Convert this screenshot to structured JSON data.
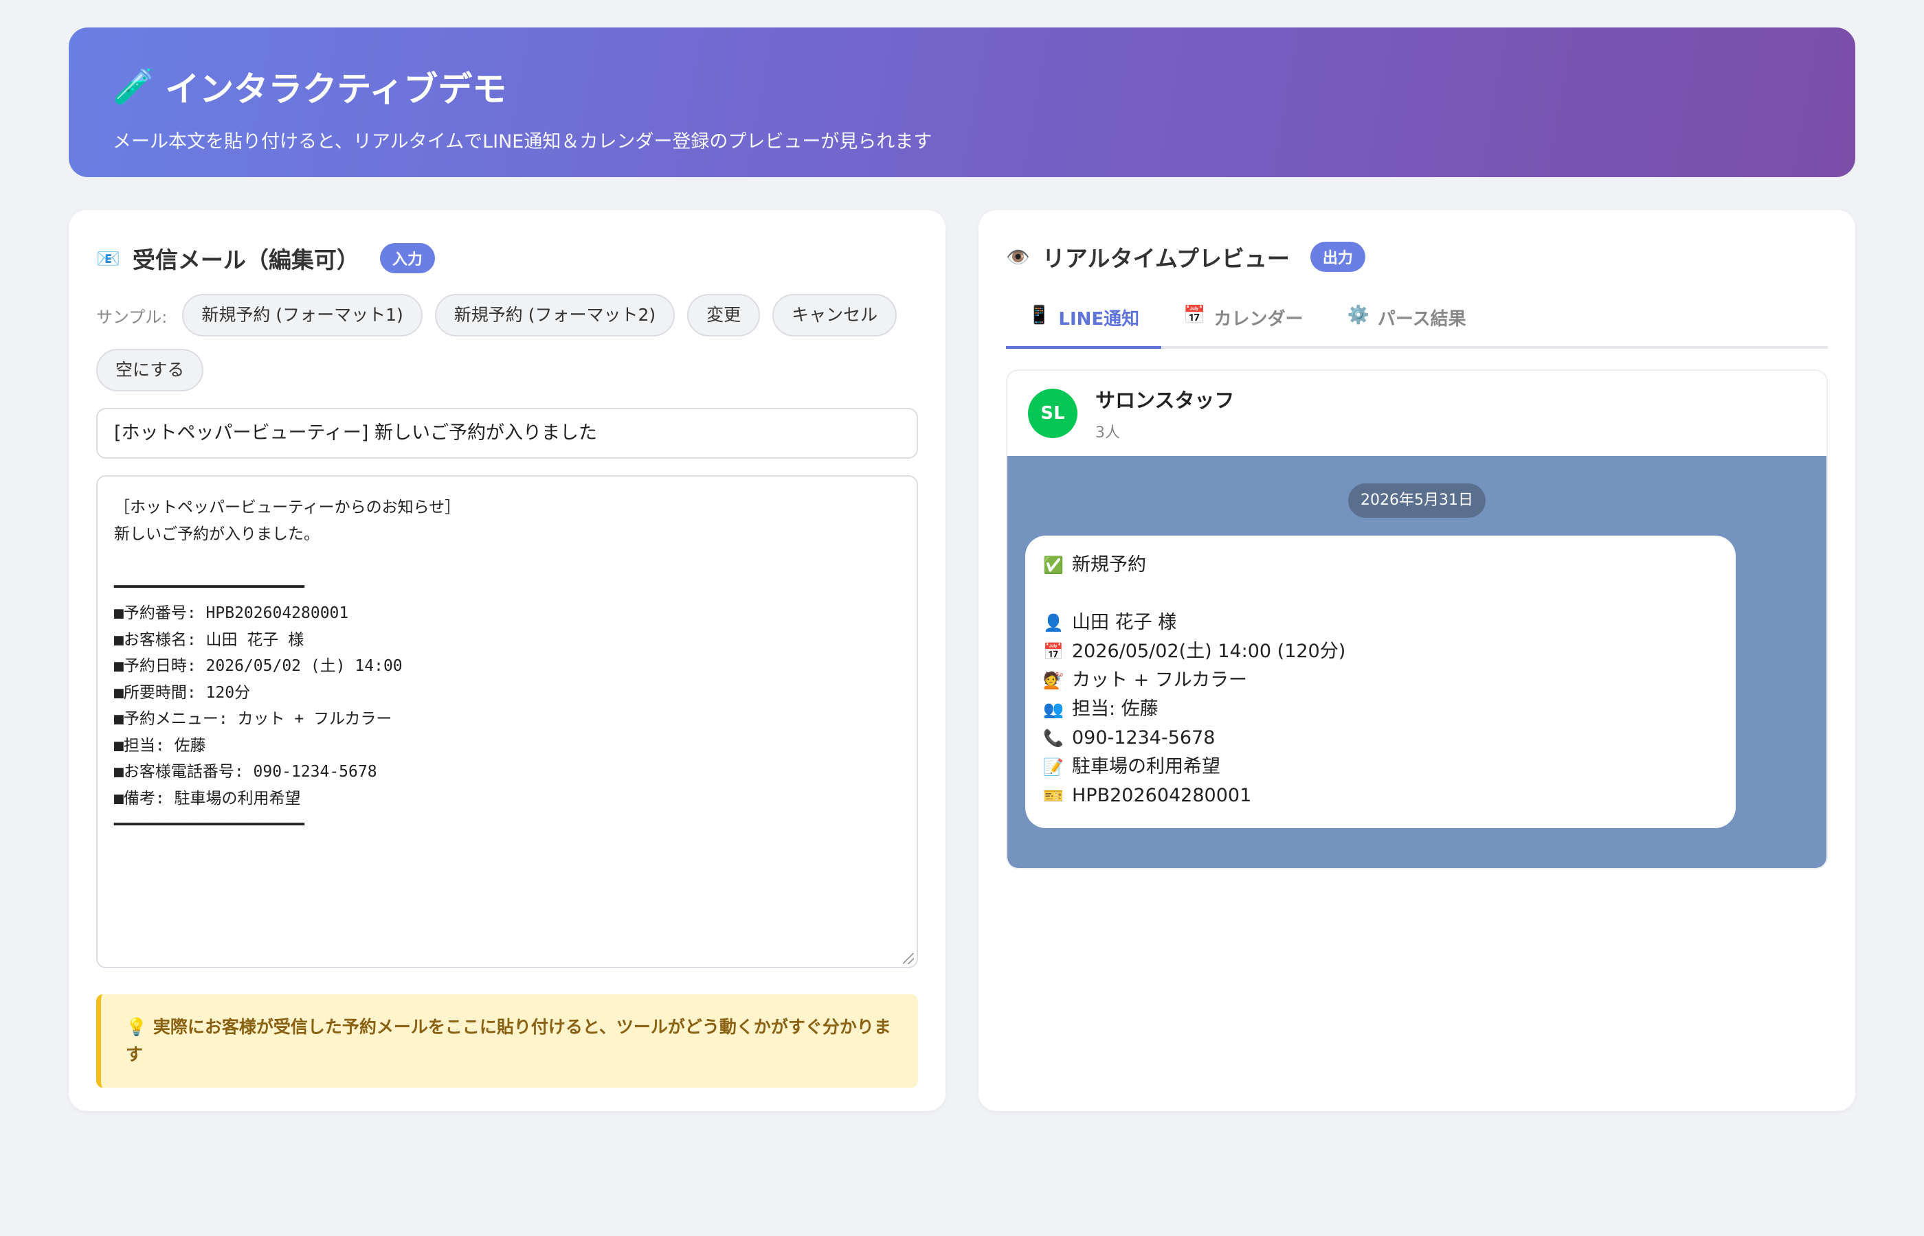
{
  "header": {
    "title": "インタラクティブデモ",
    "subtitle": "メール本文を貼り付けると、リアルタイムでLINE通知＆カレンダー登録のプレビューが見られます"
  },
  "input_card": {
    "title": "受信メール（編集可）",
    "badge": "入力",
    "samples_label": "サンプル:",
    "samples": [
      "新規予約 (フォーマット1)",
      "新規予約 (フォーマット2)",
      "変更",
      "キャンセル",
      "空にする"
    ],
    "subject": "[ホットペッパービューティー] 新しいご予約が入りました",
    "body": "［ホットペッパービューティーからのお知らせ］\n新しいご予約が入りました。\n\n━━━━━━━━━━━━━━━━━━━━\n■予約番号: HPB202604280001\n■お客様名: 山田 花子 様\n■予約日時: 2026/05/02 (土) 14:00\n■所要時間: 120分\n■予約メニュー: カット + フルカラー\n■担当: 佐藤\n■お客様電話番号: 090-1234-5678\n■備考: 駐車場の利用希望\n━━━━━━━━━━━━━━━━━━━━",
    "tip": "実際にお客様が受信した予約メールをここに貼り付けると、ツールがどう動くかがすぐ分かります"
  },
  "preview_card": {
    "title": "リアルタイムプレビュー",
    "badge": "出力",
    "tabs": [
      "LINE通知",
      "カレンダー",
      "パース結果"
    ],
    "line": {
      "avatar": "SL",
      "group_name": "サロンスタッフ",
      "member_count": "3人",
      "date": "2026年5月31日",
      "message_title": "新規予約",
      "lines": [
        "山田 花子 様",
        "2026/05/02(土) 14:00 (120分)",
        "カット + フルカラー",
        "担当: 佐藤",
        "090-1234-5678",
        "駐車場の利用希望",
        "HPB202604280001"
      ]
    }
  },
  "colors": {
    "accent": "#6a7fe3",
    "line_green": "#06c755",
    "chat_bg": "#7494bf"
  }
}
